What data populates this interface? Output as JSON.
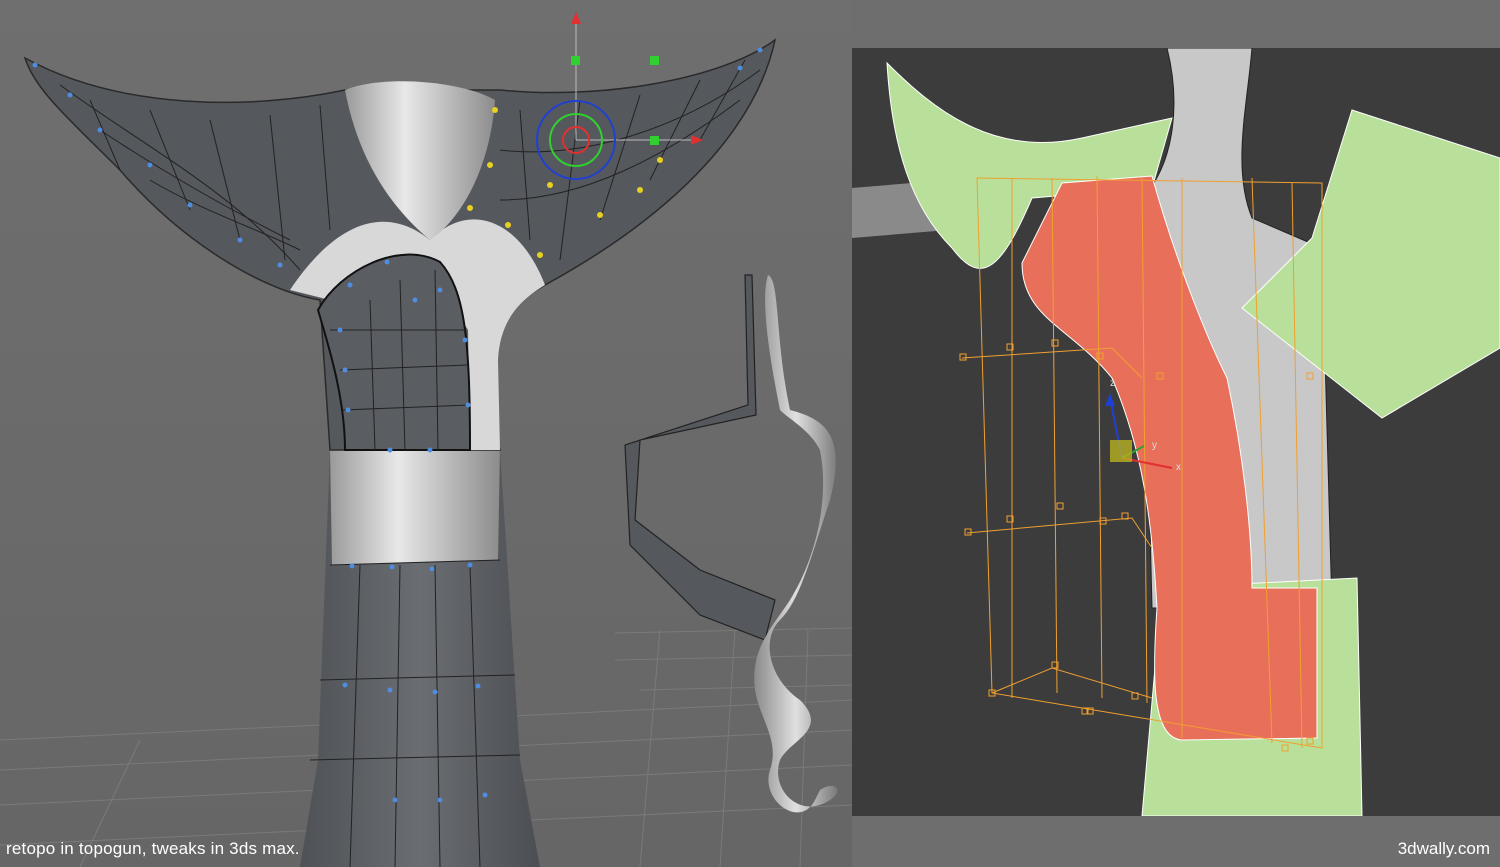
{
  "caption": "retopo in topogun, tweaks in 3ds max.",
  "watermark": "3dwally.com",
  "colors": {
    "background": "#6e6e6e",
    "right_viewport": "#3c3c3c",
    "mesh_dark": "#5a5d62",
    "mesh_light": "#d8d8d8",
    "selected_face": "#e8705a",
    "green_panel": "#b8e09a",
    "lattice_orange": "#f0a030",
    "vertex_blue": "#4f8de0",
    "vertex_yellow": "#e8d020",
    "gizmo_red": "#e03030",
    "gizmo_green": "#30d030",
    "gizmo_blue": "#2040d0"
  },
  "gizmo_axes": {
    "x": "x",
    "y": "y",
    "z": "z"
  }
}
